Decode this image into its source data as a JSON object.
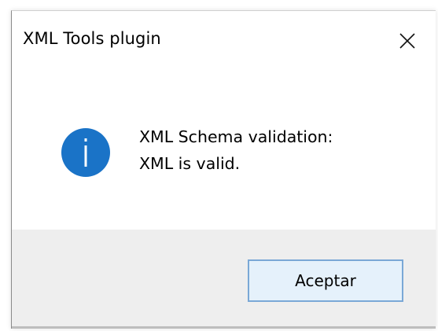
{
  "dialog": {
    "title": "XML Tools plugin",
    "message_line1": "XML Schema validation:",
    "message_line2": "XML is valid.",
    "ok_label": "Aceptar"
  },
  "icons": {
    "close": "close-icon",
    "info": "info-icon"
  },
  "colors": {
    "info_icon_fill": "#1a73c7",
    "button_fill": "#e5f1fb",
    "button_border": "#7aa8d6",
    "footer_bg": "#eeeeee"
  }
}
